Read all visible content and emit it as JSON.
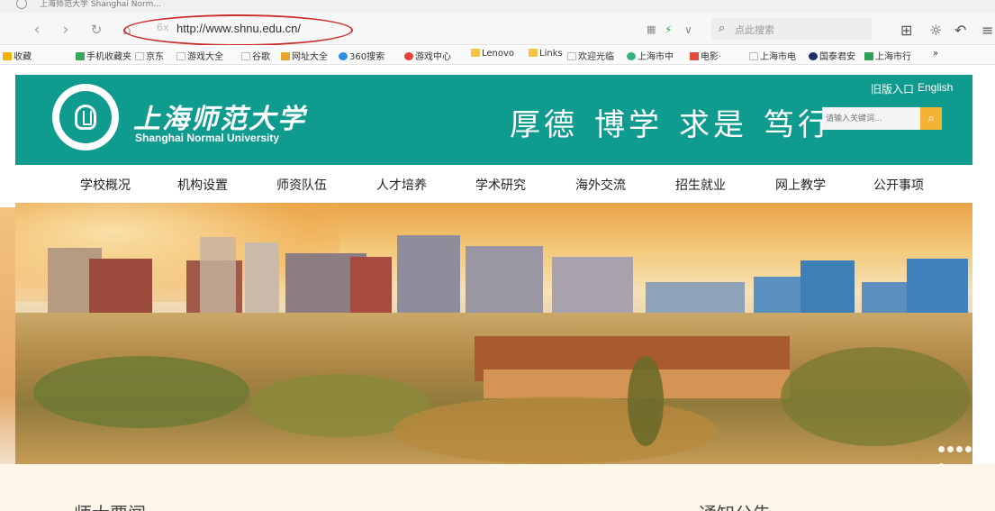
{
  "browser": {
    "tab_title": "上海师范大学 Shanghai Norm...",
    "url": "http://www.shnu.edu.cn/",
    "search_placeholder": "点此搜索",
    "bookmarks": [
      "收藏",
      "手机收藏夹",
      "京东",
      "游戏大全",
      "谷歌",
      "网址大全",
      "360搜索",
      "游戏中心",
      "Lenovo",
      "Links",
      "欢迎光临",
      "上海市中",
      "电影·",
      "上海市电",
      "国泰君安",
      "上海市行",
      "»"
    ]
  },
  "site": {
    "cn_name": "上海师范大学",
    "en_name": "Shanghai Normal University",
    "motto": [
      "厚德",
      "博学",
      "求是",
      "笃行"
    ],
    "old_version": "旧版入口",
    "english": "English",
    "search_placeholder": "请输入关键词...",
    "nav": [
      "学校概况",
      "机构设置",
      "师资队伍",
      "人才培养",
      "学术研究",
      "海外交流",
      "招生就业",
      "网上教学",
      "公开事项"
    ],
    "sections": [
      "师大要闻",
      "通知公告"
    ]
  },
  "colors": {
    "brand_teal": "#109b8f",
    "search_button": "#f2b233",
    "url_highlight": "#c9302c"
  }
}
